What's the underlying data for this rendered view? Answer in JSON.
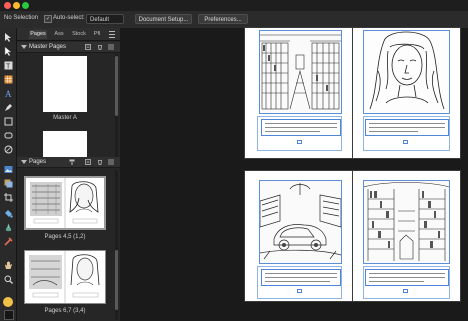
{
  "window": {
    "traffic_lights": [
      "#ff5f57",
      "#febc2e",
      "#28c840"
    ]
  },
  "toolbar": {
    "selection": "No Selection",
    "auto_select_label": "Auto-select:",
    "auto_select_value": "Default",
    "document_setup": "Document Setup...",
    "preferences": "Preferences..."
  },
  "tools": [
    "pointer-icon",
    "node-icon",
    "frame-text-icon",
    "table-icon",
    "artistic-text-icon",
    "pen-icon",
    "rectangle-icon",
    "rounded-rect-icon",
    "ellipse-icon",
    "picture-frame-icon",
    "place-image-icon",
    "crop-icon",
    "fill-icon",
    "transparency-icon",
    "color-picker-icon",
    "hand-icon",
    "zoom-icon"
  ],
  "panel": {
    "tabs": [
      "Pages",
      "Ass",
      "Stock",
      "Pfl"
    ],
    "active_tab": "Pages",
    "master_pages": {
      "title": "Master Pages",
      "items": [
        {
          "label": "Master A"
        }
      ]
    },
    "pages": {
      "title": "Pages",
      "spreads": [
        {
          "label": "Pages 4,5 (1,2)"
        },
        {
          "label": "Pages 6,7 (3,4)"
        }
      ]
    }
  },
  "colors": {
    "accent_frame": "#4f86d8",
    "ui_background": "#1b1b1b"
  }
}
